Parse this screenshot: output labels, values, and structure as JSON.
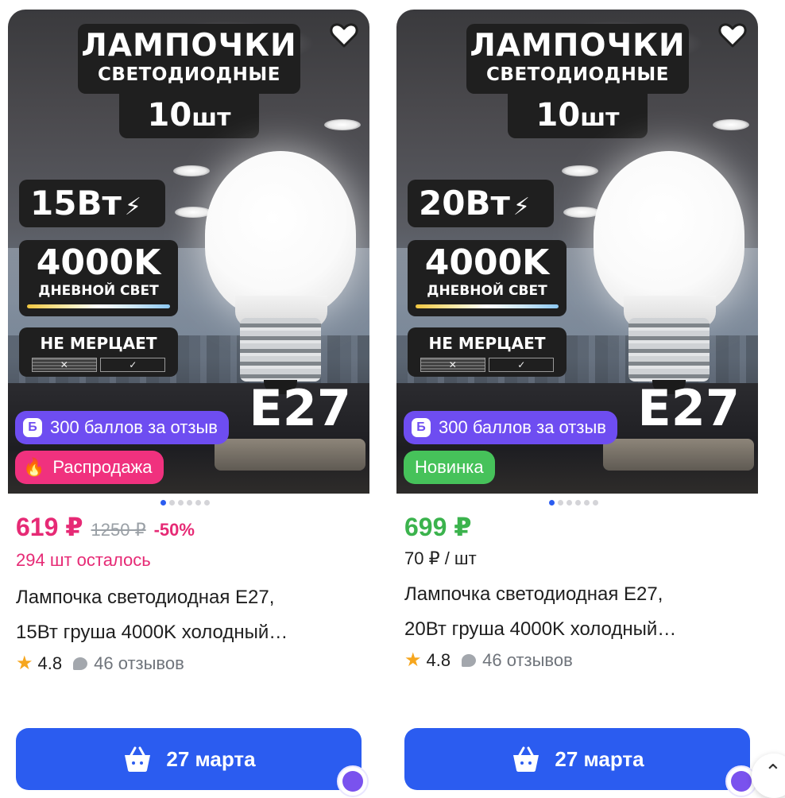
{
  "products": [
    {
      "image": {
        "title_line1": "ЛАМПОЧКИ",
        "title_line2": "СВЕТОДИОДНЫЕ",
        "qty_num": "10",
        "qty_unit": "шт",
        "watt": "15Вт",
        "bolt": "⚡",
        "kelvin": "4000K",
        "kelvin_sub": "ДНЕВНОЙ СВЕТ",
        "flicker": "НЕ МЕРЦАЕТ",
        "mark_x": "✕",
        "mark_check": "✓",
        "socket": "E27"
      },
      "bonus_badge": {
        "icon": "Б",
        "label": "300 баллов за отзыв"
      },
      "tag_badge": {
        "type": "sale",
        "icon": "🔥",
        "label": "Распродажа"
      },
      "dots_total": 6,
      "dots_active": 1,
      "price": "619 ₽",
      "old_price": "1250 ₽",
      "discount": "-50%",
      "sub_line": "294 шт осталось",
      "name_line1": "Лампочка светодиодная E27,",
      "name_line2": "15Вт груша 4000K холодный…",
      "rating": "4.8",
      "reviews": "46 отзывов",
      "delivery_label": "27 марта"
    },
    {
      "image": {
        "title_line1": "ЛАМПОЧКИ",
        "title_line2": "СВЕТОДИОДНЫЕ",
        "qty_num": "10",
        "qty_unit": "шт",
        "watt": "20Вт",
        "bolt": "⚡",
        "kelvin": "4000K",
        "kelvin_sub": "ДНЕВНОЙ СВЕТ",
        "flicker": "НЕ МЕРЦАЕТ",
        "mark_x": "✕",
        "mark_check": "✓",
        "socket": "E27"
      },
      "bonus_badge": {
        "icon": "Б",
        "label": "300 баллов за отзыв"
      },
      "tag_badge": {
        "type": "new",
        "label": "Новинка"
      },
      "dots_total": 6,
      "dots_active": 1,
      "price": "699 ₽",
      "sub_line": "70 ₽ / шт",
      "name_line1": "Лампочка светодиодная E27,",
      "name_line2": "20Вт груша 4000K холодный…",
      "rating": "4.8",
      "reviews": "46 отзывов",
      "delivery_label": "27 марта"
    }
  ],
  "scroll_top_icon": "⌃",
  "icons": {
    "favorite": "heart-icon",
    "basket": "basket-icon",
    "crown": "crown-icon",
    "star": "★"
  },
  "colors": {
    "accent_blue": "#2b5cf0",
    "sale_pink": "#e62a75",
    "new_green": "#46c25a",
    "bonus_purple": "#6e4df1",
    "rating_star": "#f6a61e"
  }
}
